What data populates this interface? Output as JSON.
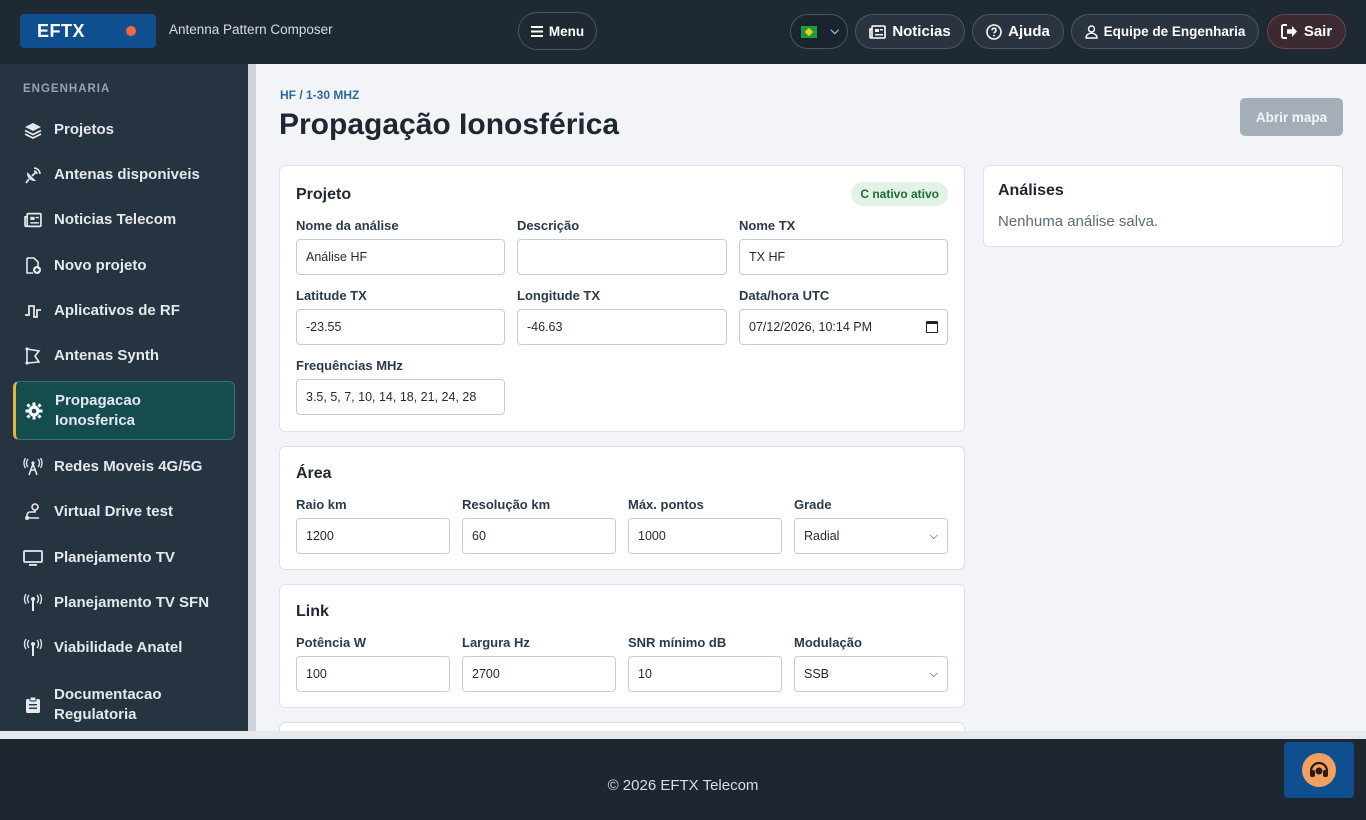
{
  "header": {
    "brand": "EFTX",
    "subtitle": "Antenna Pattern Composer",
    "menu_label": "Menu",
    "news_label": "Noticias",
    "help_label": "Ajuda",
    "team_label": "Equipe de Engenharia",
    "logout_label": "Sair"
  },
  "sidebar": {
    "section": "ENGENHARIA",
    "items": [
      {
        "label": "Projetos",
        "icon": "layers-icon"
      },
      {
        "label": "Antenas disponiveis",
        "icon": "satellite-dish-icon"
      },
      {
        "label": "Noticias Telecom",
        "icon": "newspaper-icon"
      },
      {
        "label": "Novo projeto",
        "icon": "file-plus-icon"
      },
      {
        "label": "Aplicativos de RF",
        "icon": "pulse-icon"
      },
      {
        "label": "Antenas Synth",
        "icon": "antenna-synth-icon"
      },
      {
        "label": "Propagacao Ionosferica",
        "icon": "gear-icon",
        "active": true
      },
      {
        "label": "Redes Moveis 4G/5G",
        "icon": "cell-tower-icon"
      },
      {
        "label": "Virtual Drive test",
        "icon": "route-icon"
      },
      {
        "label": "Planejamento TV",
        "icon": "monitor-icon"
      },
      {
        "label": "Planejamento TV SFN",
        "icon": "broadcast-icon"
      },
      {
        "label": "Viabilidade Anatel",
        "icon": "broadcast-icon"
      },
      {
        "label": "Documentacao Regulatoria",
        "icon": "clipboard-icon"
      }
    ]
  },
  "page": {
    "breadcrumb": "HF / 1-30 MHZ",
    "title": "Propagação Ionosférica",
    "map_button": "Abrir mapa"
  },
  "project": {
    "title": "Projeto",
    "badge": "C nativo ativo",
    "fields": {
      "name_label": "Nome da análise",
      "name_value": "Análise HF",
      "desc_label": "Descrição",
      "desc_value": "",
      "tx_label": "Nome TX",
      "tx_value": "TX HF",
      "lat_label": "Latitude TX",
      "lat_value": "-23.55",
      "lon_label": "Longitude TX",
      "lon_value": "-46.63",
      "date_label": "Data/hora UTC",
      "date_value": "07/12/2026, 10:14 PM",
      "freq_label": "Frequências MHz",
      "freq_value": "3.5, 5, 7, 10, 14, 18, 21, 24, 28"
    }
  },
  "area": {
    "title": "Área",
    "radius_label": "Raio km",
    "radius_value": "1200",
    "res_label": "Resolução km",
    "res_value": "60",
    "max_label": "Máx. pontos",
    "max_value": "1000",
    "grid_label": "Grade",
    "grid_value": "Radial"
  },
  "link": {
    "title": "Link",
    "power_label": "Potência W",
    "power_value": "100",
    "bw_label": "Largura Hz",
    "bw_value": "2700",
    "snr_label": "SNR mínimo dB",
    "snr_value": "10",
    "mod_label": "Modulação",
    "mod_value": "SSB"
  },
  "analyses": {
    "title": "Análises",
    "empty": "Nenhuma análise salva."
  },
  "footer": {
    "copyright": "© 2026 EFTX Telecom"
  }
}
